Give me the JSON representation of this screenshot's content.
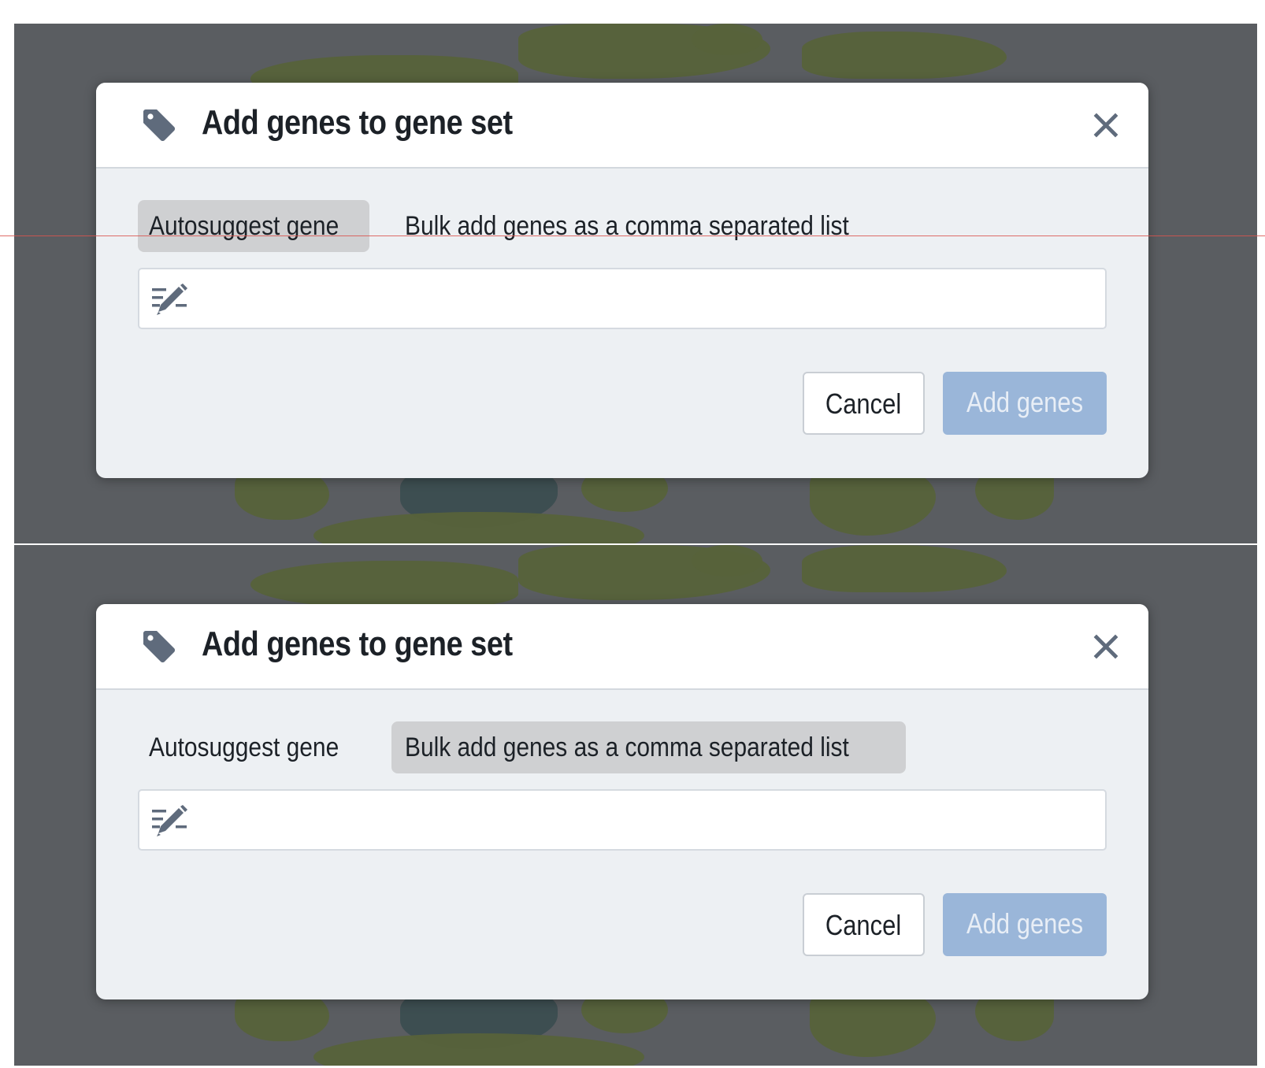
{
  "dialogs": [
    {
      "title": "Add genes to gene set",
      "tabs": [
        "Autosuggest gene",
        "Bulk add genes as a comma separated list"
      ],
      "active_tab": "Autosuggest gene",
      "input_value": "",
      "cancel_label": "Cancel",
      "add_label": "Add genes",
      "add_disabled": true
    },
    {
      "title": "Add genes to gene set",
      "tabs": [
        "Autosuggest gene",
        "Bulk add genes as a comma separated list"
      ],
      "active_tab": "Bulk add genes as a comma separated list",
      "input_value": "",
      "cancel_label": "Cancel",
      "add_label": "Add genes",
      "add_disabled": true
    }
  ],
  "colors": {
    "overlay": "#5a5d61",
    "dialog_body": "#edf0f3",
    "active_tab": "#cfd0d2",
    "primary_disabled": "#9ab6d9",
    "icon": "#5f6b7c"
  },
  "icons": {
    "title_icon": "tag-icon",
    "close_icon": "close-icon",
    "input_icon": "edit-icon"
  }
}
